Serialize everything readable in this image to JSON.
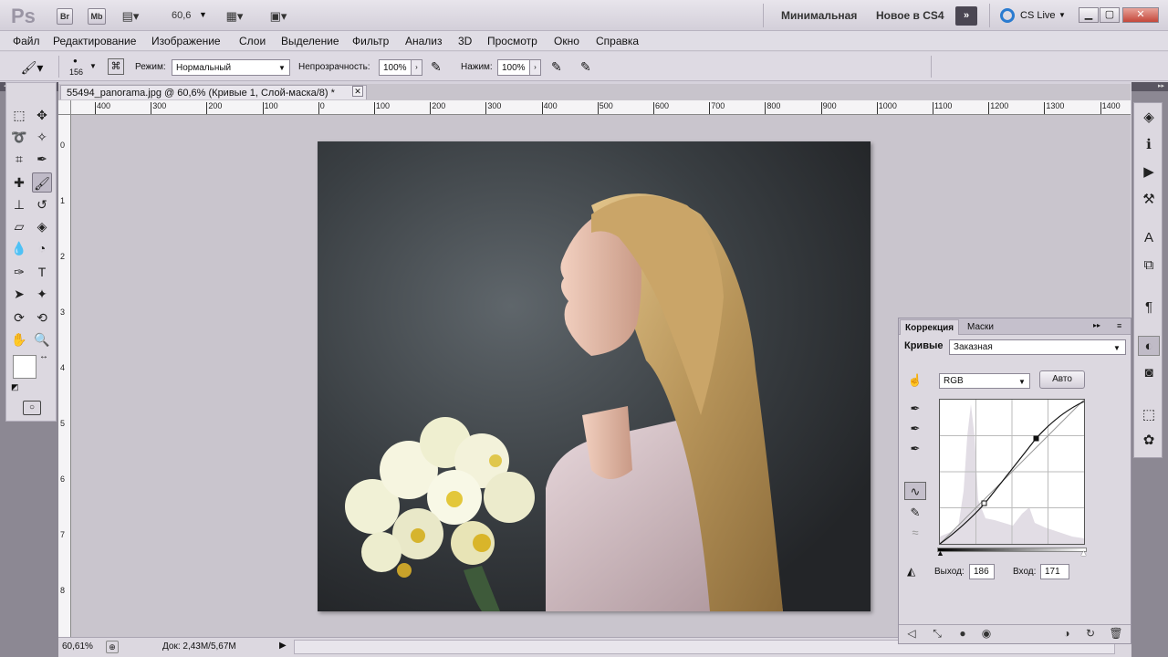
{
  "titlebar": {
    "logo": "Ps",
    "br_label": "Br",
    "mb_label": "Mb",
    "zoom_value": "60,6",
    "workspace_minimal": "Минимальная",
    "workspace_new": "Новое в CS4",
    "cs_live": "CS Live"
  },
  "menu": [
    "Файл",
    "Редактирование",
    "Изображение",
    "Слои",
    "Выделение",
    "Фильтр",
    "Анализ",
    "3D",
    "Просмотр",
    "Окно",
    "Справка"
  ],
  "options": {
    "brush_size": "156",
    "mode_label": "Режим:",
    "mode_value": "Нормальный",
    "opacity_label": "Непрозрачность:",
    "opacity_value": "100%",
    "pressure_label": "Нажим:",
    "pressure_value": "100%"
  },
  "document": {
    "tab_title": "55494_panorama.jpg @ 60,6% (Кривые 1, Слой-маска/8) *",
    "hruler_ticks": [
      "400",
      "300",
      "200",
      "100",
      "0",
      "100",
      "200",
      "300",
      "400",
      "500",
      "600",
      "700",
      "800",
      "900",
      "1000",
      "1100",
      "1200",
      "1300",
      "1400"
    ],
    "vruler_ticks": [
      "0",
      "1",
      "2",
      "3",
      "4",
      "5",
      "6",
      "7",
      "8"
    ]
  },
  "status": {
    "zoom": "60,61%",
    "doc_info": "Док: 2,43M/5,67M"
  },
  "adjustments": {
    "tab_correction": "Коррекция",
    "tab_masks": "Маски",
    "curves_label": "Кривые",
    "preset_value": "Заказная",
    "channel_value": "RGB",
    "auto_button": "Авто",
    "output_label": "Выход:",
    "output_value": "186",
    "input_label": "Вход:",
    "input_value": "171"
  },
  "colors": {
    "accent": "#3b3f44",
    "panel": "#dcd8e0"
  }
}
